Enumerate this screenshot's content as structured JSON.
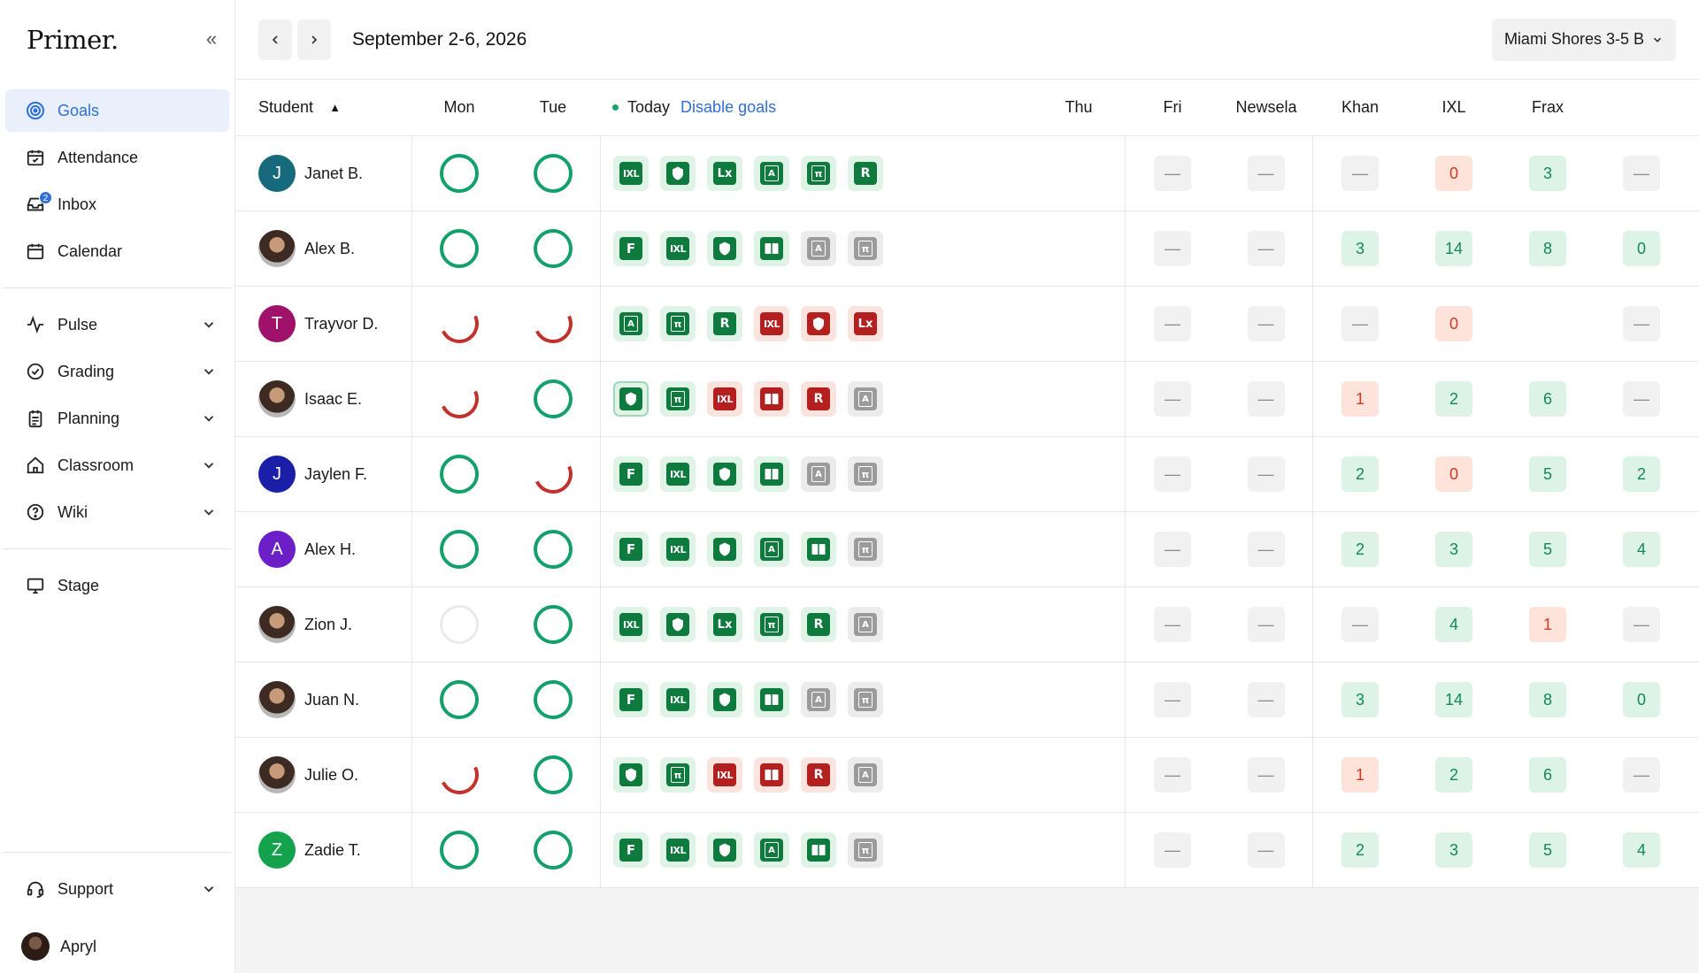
{
  "brand": {
    "logo": "Primer."
  },
  "sidebar": {
    "items": [
      {
        "label": "Goals",
        "icon": "goals-icon",
        "active": true
      },
      {
        "label": "Attendance",
        "icon": "attendance-icon"
      },
      {
        "label": "Inbox",
        "icon": "inbox-icon",
        "badge": "2"
      },
      {
        "label": "Calendar",
        "icon": "calendar-icon"
      }
    ],
    "groups": [
      {
        "label": "Pulse",
        "icon": "pulse-icon"
      },
      {
        "label": "Grading",
        "icon": "grading-icon"
      },
      {
        "label": "Planning",
        "icon": "planning-icon"
      },
      {
        "label": "Classroom",
        "icon": "classroom-icon"
      },
      {
        "label": "Wiki",
        "icon": "wiki-icon"
      }
    ],
    "stage": {
      "label": "Stage",
      "icon": "stage-icon"
    },
    "support": {
      "label": "Support",
      "icon": "support-icon"
    },
    "user": {
      "name": "Apryl"
    }
  },
  "header": {
    "date_range": "September 2-6, 2026",
    "class_selector": "Miami Shores 3-5 B"
  },
  "table": {
    "headers": {
      "student": "Student",
      "mon": "Mon",
      "tue": "Tue",
      "today": "Today",
      "disable_goals": "Disable goals",
      "thu": "Thu",
      "fri": "Fri",
      "newsela": "Newsela",
      "khan": "Khan",
      "ixl": "IXL",
      "frax": "Frax"
    },
    "rows": [
      {
        "name": "Janet B.",
        "initial": "J",
        "avatar_color": "#166a7c",
        "photo": false,
        "mon": "full",
        "tue": "full",
        "apps": [
          [
            "IXL",
            "g"
          ],
          [
            "shield",
            "g"
          ],
          [
            "Lx",
            "g"
          ],
          [
            "A",
            "g"
          ],
          [
            "pi",
            "g"
          ],
          [
            "R",
            "g"
          ]
        ],
        "thu": "—",
        "fri": "—",
        "newsela": "—",
        "khan": "0",
        "ixl": "3",
        "frax": "—"
      },
      {
        "name": "Alex B.",
        "initial": "",
        "photo": true,
        "mon": "full",
        "tue": "full",
        "apps": [
          [
            "F",
            "g"
          ],
          [
            "IXL",
            "g"
          ],
          [
            "shield",
            "g"
          ],
          [
            "book",
            "g"
          ],
          [
            "A",
            "n"
          ],
          [
            "pi",
            "n"
          ]
        ],
        "thu": "—",
        "fri": "—",
        "newsela": "3",
        "khan": "14",
        "ixl": "8",
        "frax": "0"
      },
      {
        "name": "Trayvor D.",
        "initial": "T",
        "avatar_color": "#a0126a",
        "photo": false,
        "mon": "part",
        "tue": "part",
        "apps": [
          [
            "A",
            "g"
          ],
          [
            "pi",
            "g"
          ],
          [
            "R",
            "g"
          ],
          [
            "IXL",
            "r"
          ],
          [
            "shield",
            "r"
          ],
          [
            "Lx",
            "r"
          ]
        ],
        "thu": "—",
        "fri": "—",
        "newsela": "—",
        "khan": "0",
        "ixl": "",
        "frax": "—"
      },
      {
        "name": "Isaac E.",
        "initial": "",
        "photo": true,
        "mon": "part",
        "tue": "full",
        "apps": [
          [
            "shield",
            "sel"
          ],
          [
            "pi",
            "g"
          ],
          [
            "IXL",
            "r"
          ],
          [
            "book",
            "r"
          ],
          [
            "R",
            "r"
          ],
          [
            "A",
            "n"
          ]
        ],
        "thu": "—",
        "fri": "—",
        "newsela": "1",
        "khan": "2",
        "ixl": "6",
        "frax": "—"
      },
      {
        "name": "Jaylen F.",
        "initial": "J",
        "avatar_color": "#1b1fa8",
        "photo": false,
        "mon": "full",
        "tue": "part",
        "apps": [
          [
            "F",
            "g"
          ],
          [
            "IXL",
            "g"
          ],
          [
            "shield",
            "g"
          ],
          [
            "book",
            "g"
          ],
          [
            "A",
            "n"
          ],
          [
            "pi",
            "n"
          ]
        ],
        "thu": "—",
        "fri": "—",
        "newsela": "2",
        "khan": "0",
        "ixl": "5",
        "frax": "2"
      },
      {
        "name": "Alex H.",
        "initial": "A",
        "avatar_color": "#6d1fc7",
        "photo": false,
        "mon": "full",
        "tue": "full",
        "apps": [
          [
            "F",
            "g"
          ],
          [
            "IXL",
            "g"
          ],
          [
            "shield",
            "g"
          ],
          [
            "A",
            "g"
          ],
          [
            "book",
            "g"
          ],
          [
            "pi",
            "n"
          ]
        ],
        "thu": "—",
        "fri": "—",
        "newsela": "2",
        "khan": "3",
        "ixl": "5",
        "frax": "4"
      },
      {
        "name": "Zion J.",
        "initial": "",
        "photo": true,
        "mon": "empty",
        "tue": "full",
        "apps": [
          [
            "IXL",
            "g"
          ],
          [
            "shield",
            "g"
          ],
          [
            "Lx",
            "g"
          ],
          [
            "pi",
            "g"
          ],
          [
            "R",
            "g"
          ],
          [
            "A",
            "n"
          ]
        ],
        "thu": "—",
        "fri": "—",
        "newsela": "—",
        "khan": "4",
        "ixl": "1",
        "frax": "—"
      },
      {
        "name": "Juan N.",
        "initial": "",
        "photo": true,
        "mon": "full",
        "tue": "full",
        "apps": [
          [
            "F",
            "g"
          ],
          [
            "IXL",
            "g"
          ],
          [
            "shield",
            "g"
          ],
          [
            "book",
            "g"
          ],
          [
            "A",
            "n"
          ],
          [
            "pi",
            "n"
          ]
        ],
        "thu": "—",
        "fri": "—",
        "newsela": "3",
        "khan": "14",
        "ixl": "8",
        "frax": "0"
      },
      {
        "name": "Julie O.",
        "initial": "",
        "photo": true,
        "mon": "part",
        "tue": "full",
        "apps": [
          [
            "shield",
            "g"
          ],
          [
            "pi",
            "g"
          ],
          [
            "IXL",
            "r"
          ],
          [
            "book",
            "r"
          ],
          [
            "R",
            "r"
          ],
          [
            "A",
            "n"
          ]
        ],
        "thu": "—",
        "fri": "—",
        "newsela": "1",
        "khan": "2",
        "ixl": "6",
        "frax": "—"
      },
      {
        "name": "Zadie T.",
        "initial": "Z",
        "avatar_color": "#14a24d",
        "photo": false,
        "mon": "full",
        "tue": "full",
        "apps": [
          [
            "F",
            "g"
          ],
          [
            "IXL",
            "g"
          ],
          [
            "shield",
            "g"
          ],
          [
            "A",
            "g"
          ],
          [
            "book",
            "g"
          ],
          [
            "pi",
            "n"
          ]
        ],
        "thu": "—",
        "fri": "—",
        "newsela": "2",
        "khan": "3",
        "ixl": "5",
        "frax": "4"
      }
    ]
  },
  "colors": {
    "accent": "#2f6fd6",
    "success": "#14a06a",
    "danger": "#c0322b"
  }
}
